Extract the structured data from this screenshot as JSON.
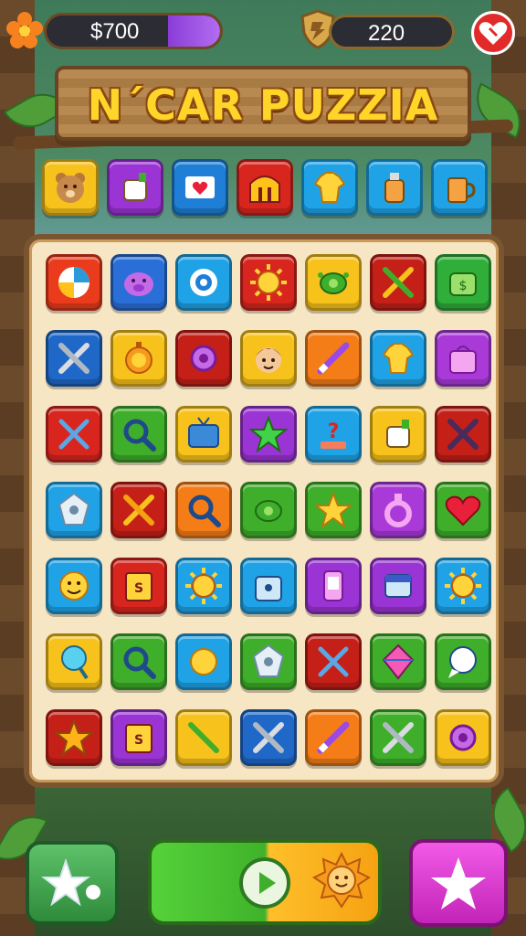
{
  "hud": {
    "money": "$700",
    "money_bar_fill": 0.3,
    "score": "220"
  },
  "title": "N´CAR PUZZIA",
  "top_row": [
    {
      "icon": "bear-face-icon",
      "color": "#f7c21b"
    },
    {
      "icon": "glue-tube-icon",
      "color": "#9b34d4"
    },
    {
      "icon": "card-heart-icon",
      "color": "#1f7fd6"
    },
    {
      "icon": "arch-gate-icon",
      "color": "#d8261f"
    },
    {
      "icon": "shirt-icon",
      "color": "#1fa3e6"
    },
    {
      "icon": "bottle-icon",
      "color": "#1fa3e6"
    },
    {
      "icon": "mug-icon",
      "color": "#1fa3e6"
    }
  ],
  "board": [
    [
      {
        "icon": "beach-ball-icon",
        "color": "#ea3b1c"
      },
      {
        "icon": "pig-face-icon",
        "color": "#2a6fd8"
      },
      {
        "icon": "ring-icon",
        "color": "#1fa3e6"
      },
      {
        "icon": "sun-gear-icon",
        "color": "#d8261f"
      },
      {
        "icon": "turtle-icon",
        "color": "#f7c21b"
      },
      {
        "icon": "crossed-pencils-icon",
        "color": "#c42018"
      },
      {
        "icon": "money-bag-icon",
        "color": "#2fae3a"
      }
    ],
    [
      {
        "icon": "crossed-wrenches-icon",
        "color": "#1f68c8"
      },
      {
        "icon": "stopwatch-icon",
        "color": "#f7c21b"
      },
      {
        "icon": "gear-icon",
        "color": "#c42018"
      },
      {
        "icon": "boy-face-icon",
        "color": "#f7c21b"
      },
      {
        "icon": "pencil-icon",
        "color": "#f57d18"
      },
      {
        "icon": "shirt-icon",
        "color": "#1fa3e6"
      },
      {
        "icon": "shopping-bag-icon",
        "color": "#a93ad8"
      }
    ],
    [
      {
        "icon": "crossed-swords-icon",
        "color": "#d8261f"
      },
      {
        "icon": "magnifier-icon",
        "color": "#3fae2a"
      },
      {
        "icon": "tv-icon",
        "color": "#f7c21b"
      },
      {
        "icon": "star-icon",
        "color": "#9b34d4"
      },
      {
        "icon": "question-block-icon",
        "color": "#1fa3e6"
      },
      {
        "icon": "glue-tube-icon",
        "color": "#f7c21b"
      },
      {
        "icon": "crossed-pens-icon",
        "color": "#c42018"
      }
    ],
    [
      {
        "icon": "gem-badge-icon",
        "color": "#1fa3e6"
      },
      {
        "icon": "crossed-sticks-icon",
        "color": "#c42018"
      },
      {
        "icon": "magnifier-icon",
        "color": "#f57d18"
      },
      {
        "icon": "turtle-icon",
        "color": "#3fae2a"
      },
      {
        "icon": "star-face-icon",
        "color": "#3fae2a"
      },
      {
        "icon": "ring-pendant-icon",
        "color": "#a93ad8"
      },
      {
        "icon": "heart-icon",
        "color": "#3fae2a"
      }
    ],
    [
      {
        "icon": "sun-face-icon",
        "color": "#1fa3e6"
      },
      {
        "icon": "book-icon",
        "color": "#d8261f"
      },
      {
        "icon": "sun-gear-icon",
        "color": "#1fa3e6"
      },
      {
        "icon": "tag-bag-icon",
        "color": "#1fa3e6"
      },
      {
        "icon": "phone-icon",
        "color": "#9b34d4"
      },
      {
        "icon": "eraser-icon",
        "color": "#9b34d4"
      },
      {
        "icon": "sun-gear-icon",
        "color": "#1fa3e6"
      }
    ],
    [
      {
        "icon": "lollipop-icon",
        "color": "#f7c21b"
      },
      {
        "icon": "magnifier-icon",
        "color": "#3fae2a"
      },
      {
        "icon": "sun-icon",
        "color": "#1fa3e6"
      },
      {
        "icon": "gem-badge-icon",
        "color": "#3fae2a"
      },
      {
        "icon": "crossed-swords-icon",
        "color": "#c42018"
      },
      {
        "icon": "kite-icon",
        "color": "#3fae2a"
      },
      {
        "icon": "speech-bubble-icon",
        "color": "#3fae2a"
      }
    ],
    [
      {
        "icon": "star-wand-icon",
        "color": "#c42018"
      },
      {
        "icon": "book-icon",
        "color": "#9b34d4"
      },
      {
        "icon": "crossed-pencils-icon",
        "color": "#f7c21b"
      },
      {
        "icon": "crossed-wrenches-icon",
        "color": "#1f68c8"
      },
      {
        "icon": "pencil-icon",
        "color": "#f57d18"
      },
      {
        "icon": "crossed-wrenches-icon",
        "color": "#3fae2a"
      },
      {
        "icon": "gear-icon",
        "color": "#f7c21b"
      }
    ]
  ],
  "controls": {
    "left": "star-wand-icon",
    "center": "play-icon",
    "center_badge": "sun-face-icon",
    "right": "magic-star-icon"
  }
}
